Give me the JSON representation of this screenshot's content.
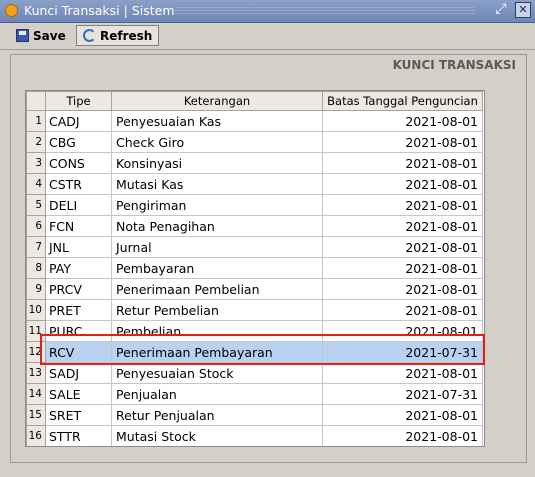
{
  "window": {
    "title": "Kunci Transaksi | Sistem",
    "restore_icon": "restore-icon",
    "close_icon": "close-icon"
  },
  "toolbar": {
    "save_label": "Save",
    "refresh_label": "Refresh"
  },
  "panel": {
    "title": "KUNCI TRANSAKSI"
  },
  "grid": {
    "columns": [
      "Tipe",
      "Keterangan",
      "Batas Tanggal Penguncian"
    ],
    "rows": [
      {
        "no": "1",
        "tipe": "CADJ",
        "keterangan": "Penyesuaian Kas",
        "tanggal": "2021-08-01"
      },
      {
        "no": "2",
        "tipe": "CBG",
        "keterangan": "Check Giro",
        "tanggal": "2021-08-01"
      },
      {
        "no": "3",
        "tipe": "CONS",
        "keterangan": "Konsinyasi",
        "tanggal": "2021-08-01"
      },
      {
        "no": "4",
        "tipe": "CSTR",
        "keterangan": "Mutasi Kas",
        "tanggal": "2021-08-01"
      },
      {
        "no": "5",
        "tipe": "DELI",
        "keterangan": "Pengiriman",
        "tanggal": "2021-08-01"
      },
      {
        "no": "6",
        "tipe": "FCN",
        "keterangan": "Nota Penagihan",
        "tanggal": "2021-08-01"
      },
      {
        "no": "7",
        "tipe": "JNL",
        "keterangan": "Jurnal",
        "tanggal": "2021-08-01"
      },
      {
        "no": "8",
        "tipe": "PAY",
        "keterangan": "Pembayaran",
        "tanggal": "2021-08-01"
      },
      {
        "no": "9",
        "tipe": "PRCV",
        "keterangan": "Penerimaan Pembelian",
        "tanggal": "2021-08-01"
      },
      {
        "no": "10",
        "tipe": "PRET",
        "keterangan": "Retur Pembelian",
        "tanggal": "2021-08-01"
      },
      {
        "no": "11",
        "tipe": "PURC",
        "keterangan": "Pembelian",
        "tanggal": "2021-08-01"
      },
      {
        "no": "12",
        "tipe": "RCV",
        "keterangan": "Penerimaan Pembayaran",
        "tanggal": "2021-07-31"
      },
      {
        "no": "13",
        "tipe": "SADJ",
        "keterangan": "Penyesuaian Stock",
        "tanggal": "2021-08-01"
      },
      {
        "no": "14",
        "tipe": "SALE",
        "keterangan": "Penjualan",
        "tanggal": "2021-07-31"
      },
      {
        "no": "15",
        "tipe": "SRET",
        "keterangan": "Retur Penjualan",
        "tanggal": "2021-08-01"
      },
      {
        "no": "16",
        "tipe": "STTR",
        "keterangan": "Mutasi Stock",
        "tanggal": "2021-08-01"
      }
    ],
    "selected_row": 12
  },
  "colors": {
    "selection": "#b8d3f2",
    "highlight": "#e02020",
    "titlebar": "#7a90bf"
  }
}
